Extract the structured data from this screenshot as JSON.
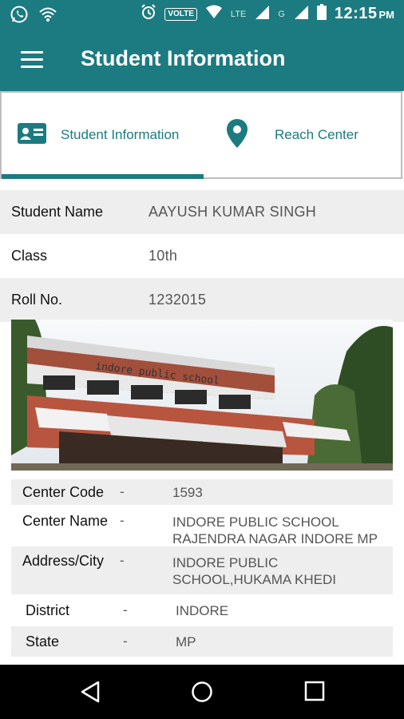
{
  "status_bar": {
    "time": "12:15",
    "ampm": "PM",
    "volte_label": "VOLTE",
    "lte_label": "LTE",
    "g_label": "G"
  },
  "app_bar": {
    "title": "Student Information",
    "menu_icon": "hamburger-menu-icon"
  },
  "tabs": [
    {
      "label": "Student Information",
      "icon": "id-card-icon",
      "selected": true
    },
    {
      "label": "Reach Center",
      "icon": "location-pin-icon",
      "selected": false
    }
  ],
  "student": {
    "name_label": "Student Name",
    "name_value": "AAYUSH KUMAR SINGH",
    "class_label": "Class",
    "class_value": "10th",
    "roll_label": "Roll No.",
    "roll_value": "1232015"
  },
  "center": {
    "rows": [
      {
        "label": "Center Code",
        "dash": "-",
        "value": "1593"
      },
      {
        "label": "Center Name",
        "dash": "-",
        "value": "INDORE PUBLIC SCHOOL RAJENDRA NAGAR INDORE MP"
      },
      {
        "label": "Address/City",
        "dash": "-",
        "value": "INDORE PUBLIC SCHOOL,HUKAMA KHEDI"
      },
      {
        "label": "District",
        "dash": "-",
        "value": "INDORE"
      },
      {
        "label": "State",
        "dash": "-",
        "value": "MP"
      }
    ]
  },
  "photo": {
    "sign_text": "indore public school"
  },
  "colors": {
    "primary": "#1c7b80",
    "row_shade": "#eeeeee"
  }
}
